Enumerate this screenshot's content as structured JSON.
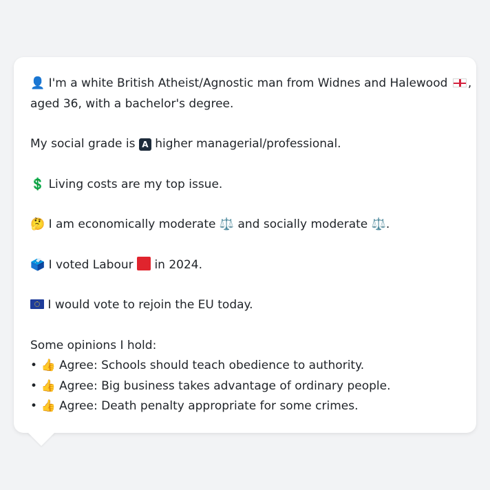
{
  "profile": {
    "intro_part1": "I'm a white British Atheist/Agnostic man from Widnes and Halewood",
    "intro_part2": ",",
    "intro_line2": "aged 36, with a bachelor's degree.",
    "social_grade_prefix": "My social grade is",
    "social_grade_letter": "A",
    "social_grade_suffix": "higher managerial/professional.",
    "top_issue": "Living costs are my top issue.",
    "econ_prefix": "I am economically moderate",
    "econ_middle": "and socially moderate",
    "econ_end": ".",
    "vote_prefix": "I voted Labour",
    "vote_suffix": "in 2024.",
    "eu_stance": "I would vote to rejoin the EU today.",
    "opinions_heading": "Some opinions I hold:",
    "opinions": [
      "Agree: Schools should teach obedience to authority.",
      "Agree: Big business takes advantage of ordinary people.",
      "Agree: Death penalty appropriate for some crimes."
    ],
    "bullet": "•"
  },
  "icons": {
    "person": "👤",
    "money": "💲",
    "thinking": "🤔",
    "scales": "⚖️",
    "ballot": "🗳️",
    "thumbs_up": "👍"
  },
  "colors": {
    "background": "#f2f3f5",
    "bubble": "#ffffff",
    "text": "#1f2328",
    "labour_red": "#e0242d",
    "eu_blue": "#1e3c9a"
  }
}
